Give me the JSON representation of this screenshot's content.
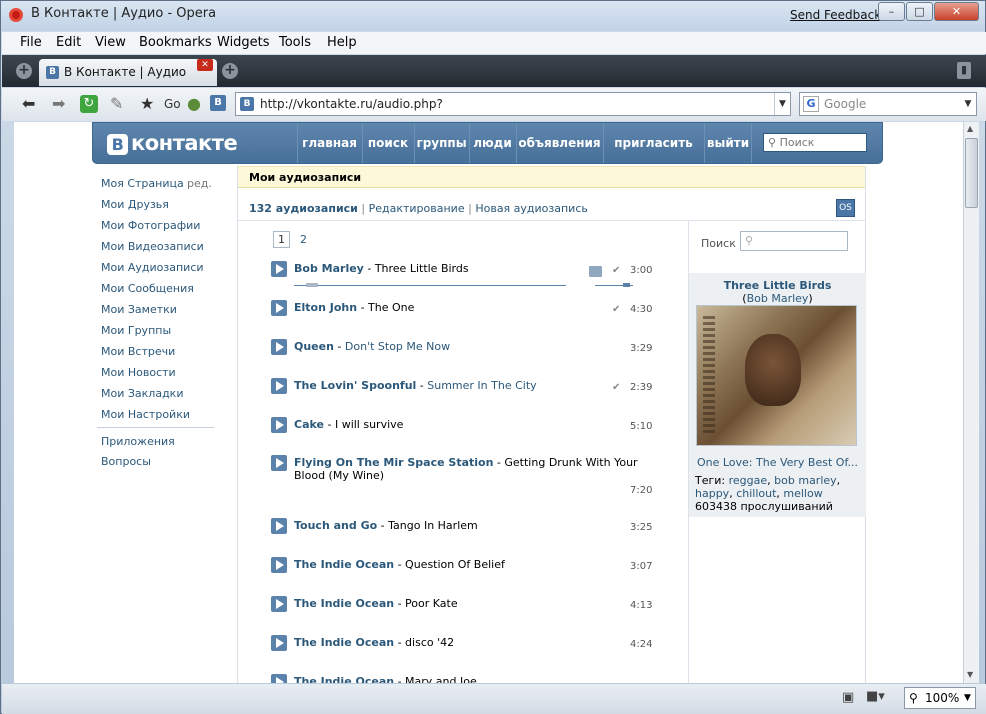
{
  "window": {
    "title": "В Контакте | Аудио - Opera",
    "feedback": "Send Feedback"
  },
  "menu": [
    "File",
    "Edit",
    "View",
    "Bookmarks",
    "Widgets",
    "Tools",
    "Help"
  ],
  "tab": {
    "label": "В Контакте | Аудио",
    "favicon": "В"
  },
  "nav": {
    "go": "Go",
    "url": "http://vkontakte.ru/audio.php?",
    "search_engine": "G",
    "search_placeholder": "Google",
    "favicon": "В"
  },
  "status": {
    "zoom": "100%"
  },
  "vk": {
    "logo_letter": "B",
    "logo_text": "контакте",
    "nav": [
      "главная",
      "поиск",
      "группы",
      "люди",
      "объявления",
      "пригласить",
      "выйти"
    ],
    "search_placeholder": "Поиск",
    "sidebar": [
      "Моя Страница",
      "Мои Друзья",
      "Мои Фотографии",
      "Мои Видеозаписи",
      "Мои Аудиозаписи",
      "Мои Сообщения",
      "Мои Заметки",
      "Мои Группы",
      "Мои Встречи",
      "Мои Новости",
      "Мои Закладки",
      "Мои Настройки"
    ],
    "edit_label": "ред.",
    "sidebar_extra": [
      "Приложения",
      "Вопросы"
    ],
    "heading": "Мои аудиозаписи",
    "count": "132 аудиозаписи",
    "edit_link": "Редактирование",
    "new_link": "Новая аудиозапись",
    "os_button": "OS",
    "pages": [
      "1",
      "2"
    ],
    "right_search_label": "Поиск",
    "now_playing": {
      "title": "Three Little Birds",
      "artist": "Bob Marley",
      "artist_open": "(",
      "artist_close": ")",
      "album": "One Love: The Very Best Of...",
      "tags_label": "Теги:",
      "tags": [
        "reggae",
        "bob marley",
        "happy",
        "chillout",
        "mellow"
      ],
      "plays": "603438 прослушиваний"
    },
    "tracks": [
      {
        "artist": "Bob Marley",
        "name": "Three Little Birds",
        "duration": "3:00",
        "checked": true,
        "playing": true,
        "link": false
      },
      {
        "artist": "Elton John",
        "name": "The One",
        "duration": "4:30",
        "checked": true,
        "link": false
      },
      {
        "artist": "Queen",
        "name": "Don't Stop Me Now",
        "duration": "3:29",
        "checked": false,
        "link": true
      },
      {
        "artist": "The Lovin' Spoonful",
        "name": "Summer In The City",
        "duration": "2:39",
        "checked": true,
        "link": true
      },
      {
        "artist": "Cake",
        "name": "I will survive",
        "duration": "5:10",
        "checked": false,
        "link": false
      },
      {
        "artist": "Flying On The Mir Space Station",
        "name": "Getting Drunk With Your Blood (My Wine)",
        "duration": "7:20",
        "checked": false,
        "link": false
      },
      {
        "artist": "Touch and Go",
        "name": "Tango In Harlem",
        "duration": "3:25",
        "checked": false,
        "link": false
      },
      {
        "artist": "The Indie Ocean",
        "name": "Question Of Belief",
        "duration": "3:07",
        "checked": false,
        "link": false
      },
      {
        "artist": "The Indie Ocean",
        "name": "Poor Kate",
        "duration": "4:13",
        "checked": false,
        "link": false
      },
      {
        "artist": "The Indie Ocean",
        "name": "disco '42",
        "duration": "4:24",
        "checked": false,
        "link": false
      },
      {
        "artist": "The Indie Ocean",
        "name": "Mary and Joe",
        "duration": "",
        "checked": false,
        "link": false
      }
    ]
  }
}
